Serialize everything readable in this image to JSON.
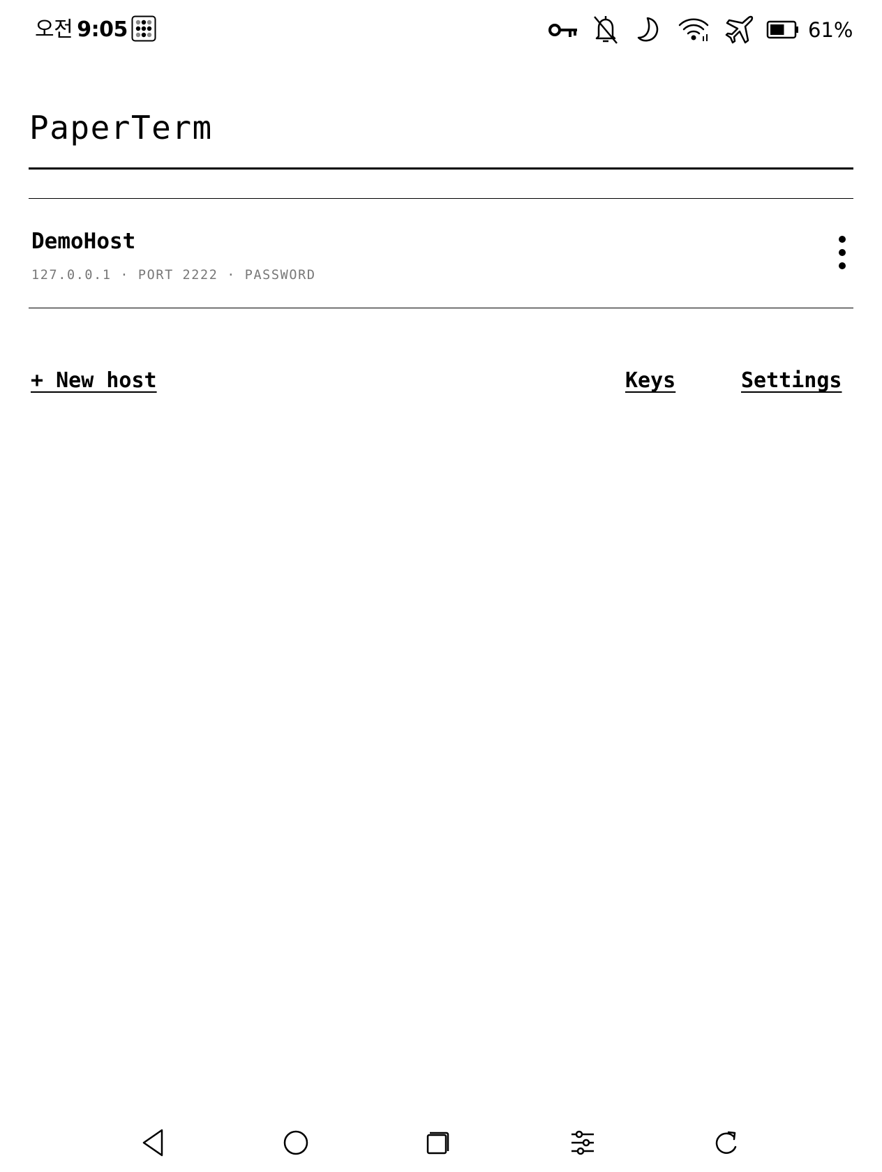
{
  "status_bar": {
    "ampm": "오전",
    "time": "9:05",
    "icons": [
      "app-notification-icon",
      "vpn-key-icon",
      "bell-off-icon",
      "do-not-disturb-moon-icon",
      "wifi-icon",
      "airplane-mode-icon",
      "battery-icon"
    ],
    "battery_percent": "61%",
    "battery_level": 0.61
  },
  "app": {
    "title": "PaperTerm"
  },
  "hosts": [
    {
      "name": "DemoHost",
      "meta": "127.0.0.1 · PORT 2222 · PASSWORD",
      "menu_icon": "more-vertical-icon"
    }
  ],
  "actions": {
    "new_host": "+ New host",
    "keys": "Keys",
    "settings": "Settings"
  },
  "nav_bar": {
    "buttons": [
      "back-icon",
      "home-icon",
      "recents-icon",
      "adjust-icon",
      "refresh-icon"
    ]
  },
  "colors": {
    "text": "#000000",
    "muted": "#777777",
    "background": "#ffffff"
  }
}
